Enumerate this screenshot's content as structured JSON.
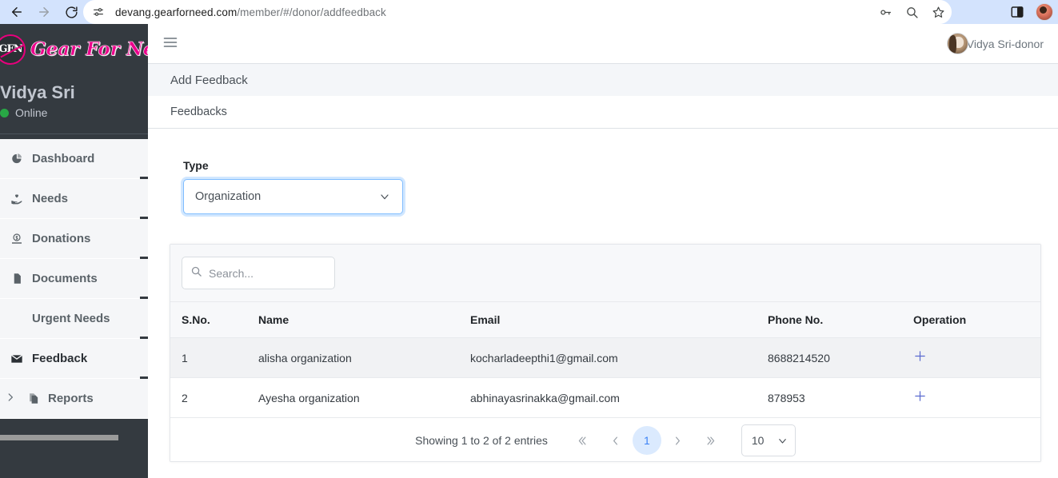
{
  "browser": {
    "back_icon": "arrow-left",
    "forward_icon": "arrow-right",
    "reload_icon": "reload",
    "site_settings_icon": "tune",
    "url_main": "devang.gearforneed.com",
    "url_path": "/member/#/donor/addfeedback",
    "passwords_icon": "key-icon",
    "zoom_icon": "magnifier-icon",
    "bookmark_icon": "star-icon",
    "sidepanel_icon": "side-panel-icon",
    "profile_icon": "profile-avatar"
  },
  "sidebar": {
    "brand_logo_text": "GFN",
    "brand_name": "Gear For Need",
    "user_name": "Vidya Sri",
    "status": "Online",
    "items": [
      {
        "label": "Dashboard",
        "icon": "pie-chart-icon",
        "active": false,
        "caret": false
      },
      {
        "label": "Needs",
        "icon": "hand-heart-icon",
        "active": false,
        "caret": false
      },
      {
        "label": "Donations",
        "icon": "donation-coin-icon",
        "active": false,
        "caret": false
      },
      {
        "label": "Documents",
        "icon": "document-icon",
        "active": false,
        "caret": false
      },
      {
        "label": "Urgent Needs",
        "icon": "",
        "active": false,
        "caret": false
      },
      {
        "label": "Feedback",
        "icon": "envelope-icon",
        "active": true,
        "caret": false
      },
      {
        "label": "Reports",
        "icon": "copy-files-icon",
        "active": false,
        "caret": true
      }
    ]
  },
  "topbar": {
    "menu_icon": "hamburger-icon",
    "user_label": "Vidya Sri-donor",
    "avatar_icon": "user-avatar"
  },
  "page": {
    "title": "Add Feedback",
    "tabs": [
      {
        "label": "Feedbacks",
        "active": true
      }
    ]
  },
  "form": {
    "type_label": "Type",
    "type_value": "Organization",
    "type_caret_icon": "chevron-down-icon"
  },
  "table": {
    "search_placeholder": "Search...",
    "search_value": "",
    "search_icon": "search-icon",
    "columns": [
      "S.No.",
      "Name",
      "Email",
      "Phone No.",
      "Operation"
    ],
    "rows": [
      {
        "sno": "1",
        "name": "alisha organization",
        "email": "kocharladeepthi1@gmail.com",
        "phone": "8688214520",
        "op_icon": "plus-icon"
      },
      {
        "sno": "2",
        "name": "Ayesha organization",
        "email": "abhinayasrinakka@gmail.com",
        "phone": "878953",
        "op_icon": "plus-icon"
      }
    ]
  },
  "pagination": {
    "info": "Showing 1 to 2 of 2 entries",
    "first_icon": "double-chevron-left-icon",
    "prev_icon": "chevron-left-icon",
    "current_page": "1",
    "next_icon": "chevron-right-icon",
    "last_icon": "double-chevron-right-icon",
    "per_page": "10",
    "per_page_caret_icon": "chevron-down-icon"
  },
  "colors": {
    "sidebar_bg": "#343a40",
    "brand_pink": "#ec008c",
    "accent_blue": "#3b82f6",
    "plus_blue": "#5a6acf",
    "online_green": "#28a745"
  }
}
